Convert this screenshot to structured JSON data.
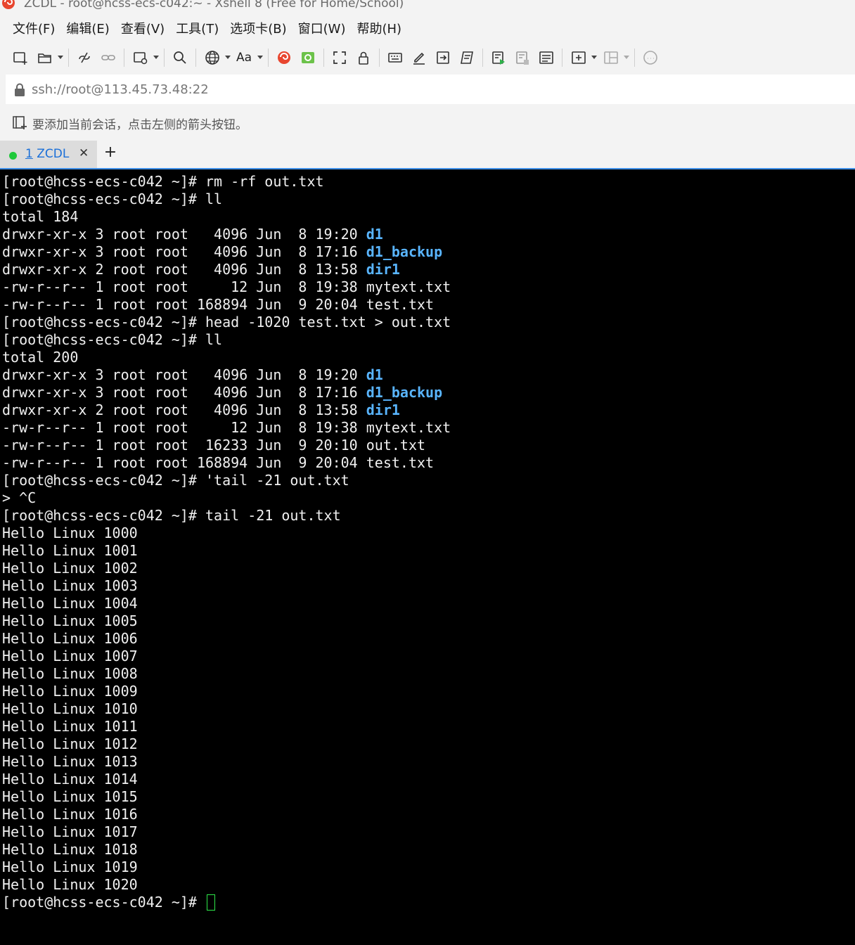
{
  "window": {
    "title": "ZCDL - root@hcss-ecs-c042:~ - Xshell 8 (Free for Home/School)"
  },
  "menu": {
    "items": [
      "文件(F)",
      "编辑(E)",
      "查看(V)",
      "工具(T)",
      "选项卡(B)",
      "窗口(W)",
      "帮助(H)"
    ]
  },
  "toolbar": {
    "font_button_label": "Aa"
  },
  "address": {
    "value": "ssh://root@113.45.73.48:22"
  },
  "hint": {
    "text": "要添加当前会话，点击左侧的箭头按钮。"
  },
  "tabs": [
    {
      "index": "1",
      "label": "ZCDL",
      "status_color": "#1fc93b"
    }
  ],
  "colors": {
    "terminal_bg": "#000000",
    "terminal_fg": "#f0f0f0",
    "directory": "#59b5ff",
    "cursor": "#2ee84a",
    "tab_accent": "#3d8ee8"
  },
  "terminal": {
    "lines": [
      {
        "text": "[root@hcss-ecs-c042 ~]# rm -rf out.txt"
      },
      {
        "text": "[root@hcss-ecs-c042 ~]# ll"
      },
      {
        "text": "total 184"
      },
      {
        "text": "drwxr-xr-x 3 root root   4096 Jun  8 19:20 ",
        "dir": "d1"
      },
      {
        "text": "drwxr-xr-x 3 root root   4096 Jun  8 17:16 ",
        "dir": "d1_backup"
      },
      {
        "text": "drwxr-xr-x 2 root root   4096 Jun  8 13:58 ",
        "dir": "dir1"
      },
      {
        "text": "-rw-r--r-- 1 root root     12 Jun  8 19:38 mytext.txt"
      },
      {
        "text": "-rw-r--r-- 1 root root 168894 Jun  9 20:04 test.txt"
      },
      {
        "text": "[root@hcss-ecs-c042 ~]# head -1020 test.txt > out.txt"
      },
      {
        "text": "[root@hcss-ecs-c042 ~]# ll"
      },
      {
        "text": "total 200"
      },
      {
        "text": "drwxr-xr-x 3 root root   4096 Jun  8 19:20 ",
        "dir": "d1"
      },
      {
        "text": "drwxr-xr-x 3 root root   4096 Jun  8 17:16 ",
        "dir": "d1_backup"
      },
      {
        "text": "drwxr-xr-x 2 root root   4096 Jun  8 13:58 ",
        "dir": "dir1"
      },
      {
        "text": "-rw-r--r-- 1 root root     12 Jun  8 19:38 mytext.txt"
      },
      {
        "text": "-rw-r--r-- 1 root root  16233 Jun  9 20:10 out.txt"
      },
      {
        "text": "-rw-r--r-- 1 root root 168894 Jun  9 20:04 test.txt"
      },
      {
        "text": "[root@hcss-ecs-c042 ~]# 'tail -21 out.txt"
      },
      {
        "text": "> ^C"
      },
      {
        "text": "[root@hcss-ecs-c042 ~]# tail -21 out.txt"
      },
      {
        "text": "Hello Linux 1000"
      },
      {
        "text": "Hello Linux 1001"
      },
      {
        "text": "Hello Linux 1002"
      },
      {
        "text": "Hello Linux 1003"
      },
      {
        "text": "Hello Linux 1004"
      },
      {
        "text": "Hello Linux 1005"
      },
      {
        "text": "Hello Linux 1006"
      },
      {
        "text": "Hello Linux 1007"
      },
      {
        "text": "Hello Linux 1008"
      },
      {
        "text": "Hello Linux 1009"
      },
      {
        "text": "Hello Linux 1010"
      },
      {
        "text": "Hello Linux 1011"
      },
      {
        "text": "Hello Linux 1012"
      },
      {
        "text": "Hello Linux 1013"
      },
      {
        "text": "Hello Linux 1014"
      },
      {
        "text": "Hello Linux 1015"
      },
      {
        "text": "Hello Linux 1016"
      },
      {
        "text": "Hello Linux 1017"
      },
      {
        "text": "Hello Linux 1018"
      },
      {
        "text": "Hello Linux 1019"
      },
      {
        "text": "Hello Linux 1020"
      },
      {
        "text": "[root@hcss-ecs-c042 ~]# ",
        "cursor": true
      }
    ]
  }
}
